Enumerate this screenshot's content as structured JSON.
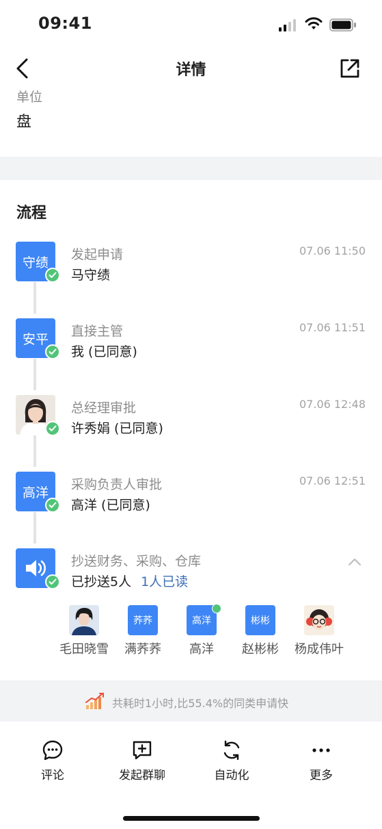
{
  "status_bar": {
    "time": "09:41"
  },
  "nav": {
    "title": "详情"
  },
  "unit": {
    "label": "单位",
    "value": "盘"
  },
  "flow": {
    "title": "流程",
    "steps": [
      {
        "avatar_text": "守绩",
        "title": "发起申请",
        "name": "马守绩",
        "time": "07.06 11:50"
      },
      {
        "avatar_text": "安平",
        "title": "直接主管",
        "name": "我 (已同意)",
        "time": "07.06 11:51"
      },
      {
        "avatar_text": "",
        "title": "总经理审批",
        "name": "许秀娟 (已同意)",
        "time": "07.06 12:48"
      },
      {
        "avatar_text": "高洋",
        "title": "采购负责人审批",
        "name": "高洋 (已同意)",
        "time": "07.06 12:51"
      },
      {
        "avatar_icon": "speaker-icon",
        "title": "抄送财务、采购、仓库",
        "name": "已抄送5人",
        "read_link": "1人已读"
      }
    ],
    "cc": [
      {
        "name": "毛田晓雪",
        "avatar": "photo"
      },
      {
        "name": "满荞荞",
        "avatar_text": "荞荞"
      },
      {
        "name": "高洋",
        "avatar_text": "高洋",
        "read": true
      },
      {
        "name": "赵彬彬",
        "avatar_text": "彬彬"
      },
      {
        "name": "杨成伟叶",
        "avatar": "cartoon"
      }
    ]
  },
  "summary": {
    "text": "共耗时1小时,比55.4%的同类申请快"
  },
  "tabbar": {
    "items": [
      {
        "label": "评论",
        "icon": "comment-icon"
      },
      {
        "label": "发起群聊",
        "icon": "group-chat-icon"
      },
      {
        "label": "自动化",
        "icon": "automation-icon"
      },
      {
        "label": "更多",
        "icon": "more-icon"
      }
    ]
  },
  "colors": {
    "accent": "#3e86f5",
    "success": "#52c478",
    "link": "#3e6fb7"
  }
}
